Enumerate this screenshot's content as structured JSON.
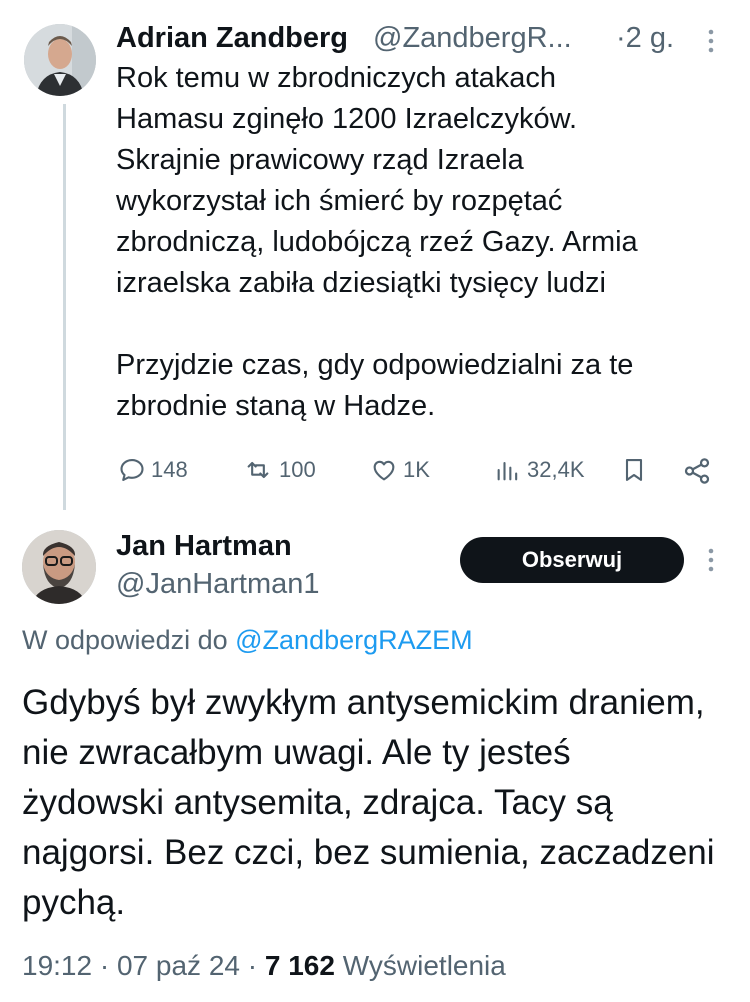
{
  "tweet1": {
    "name": "Adrian Zandberg",
    "handle": "@ZandbergR...",
    "time": "2 g.",
    "text": "Rok temu w zbrodniczych atakach\nHamasu zginęło 1200 Izraelczyków.\nSkrajnie prawicowy rząd Izraela\nwykorzystał ich śmierć by rozpętać\nzbrodniczą, ludobójczą rzeź Gazy. Armia\nizraelska zabiła dziesiątki tysięcy ludzi\n\nPrzyjdzie czas, gdy odpowiedzialni za te\nzbrodnie staną w Hadze.",
    "actions": {
      "replies": "148",
      "reposts": "100",
      "likes": "1K",
      "views": "32,4K"
    }
  },
  "tweet2": {
    "name": "Jan Hartman",
    "handle": "@JanHartman1",
    "follow_label": "Obserwuj",
    "reply_prefix": "W odpowiedzi do",
    "reply_handle": "@ZandbergRAZEM",
    "text": "Gdybyś był zwykłym antysemickim draniem, nie zwracałbym uwagi. Ale ty jesteś żydowski antysemita, zdrajca. Tacy są najgorsi. Bez czci, bez sumienia, zaczadzeni pychą.",
    "time": "19:12",
    "date": "07 paź 24",
    "views_count": "7 162",
    "views_label": "Wyświetlenia"
  },
  "icons": [
    "avatar",
    "more-icon",
    "reply-icon",
    "repost-icon",
    "like-icon",
    "views-icon",
    "bookmark-icon",
    "share-icon"
  ],
  "colors": {
    "text": "#0f1419",
    "secondary": "#536471",
    "link": "#1d9bf0",
    "button": "#0f1419"
  }
}
